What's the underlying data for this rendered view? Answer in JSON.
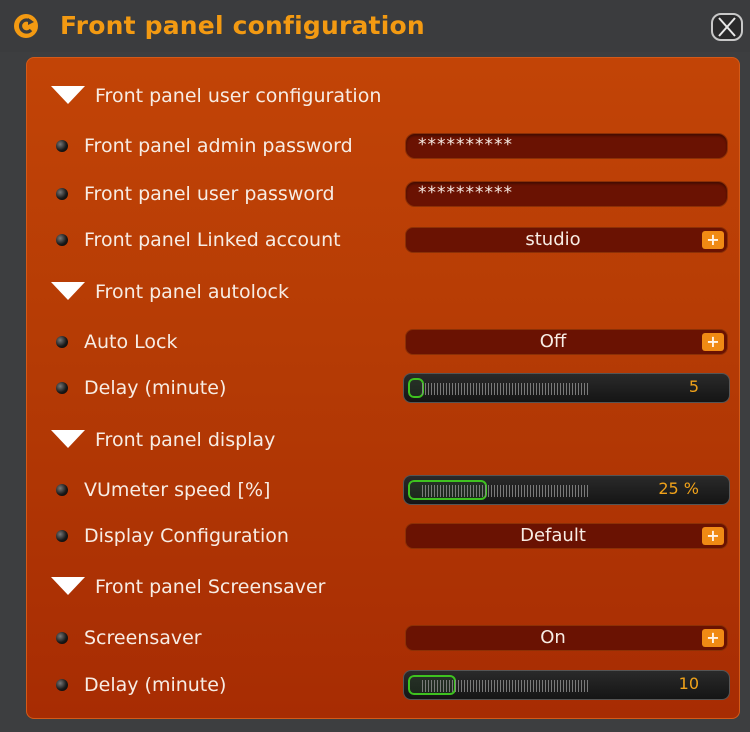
{
  "window": {
    "title": "Front panel configuration"
  },
  "colors": {
    "accent": "#f39a12",
    "panel": "#b53b05",
    "field": "#6a1202",
    "slider_fill": "#3ec21f",
    "slider_value": "#f0a21a"
  },
  "sections": {
    "user_config": {
      "label": "Front panel user configuration"
    },
    "autolock": {
      "label": "Front panel autolock"
    },
    "display": {
      "label": "Front panel display"
    },
    "screensaver": {
      "label": "Front panel Screensaver"
    }
  },
  "fields": {
    "admin_password": {
      "label": "Front panel admin password",
      "value": "**********"
    },
    "user_password": {
      "label": "Front panel user password",
      "value": "**********"
    },
    "linked_account": {
      "label": "Front panel Linked account",
      "value": "studio",
      "button": "+"
    },
    "auto_lock": {
      "label": "Auto Lock",
      "value": "Off",
      "button": "+"
    },
    "autolock_delay": {
      "label": "Delay (minute)",
      "value": "5",
      "fraction": 0.05
    },
    "vumeter_speed": {
      "label": "VUmeter speed [%]",
      "value": "25 %",
      "fraction": 0.25
    },
    "display_config": {
      "label": "Display Configuration",
      "value": "Default",
      "button": "+"
    },
    "screensaver": {
      "label": "Screensaver",
      "value": "On",
      "button": "+"
    },
    "screensaver_delay": {
      "label": "Delay (minute)",
      "value": "10",
      "fraction": 0.15
    }
  }
}
